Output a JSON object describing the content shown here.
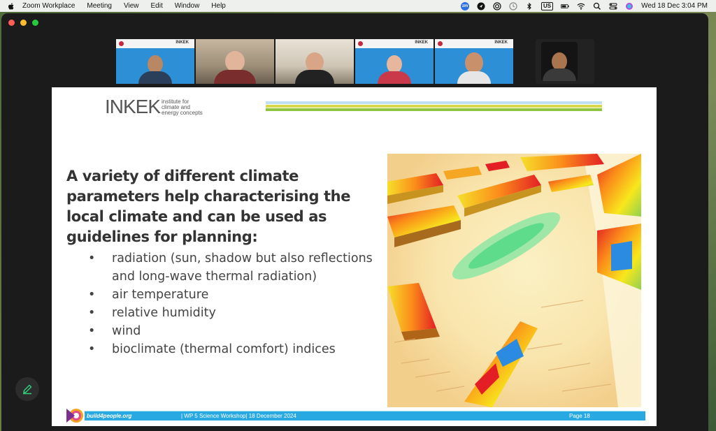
{
  "menubar": {
    "app_name": "Zoom Workplace",
    "menus": [
      "Meeting",
      "View",
      "Edit",
      "Window",
      "Help"
    ],
    "kb_layout": "US",
    "clock": "Wed 18 Dec  3:04 PM",
    "zoom_badge": "zm"
  },
  "participants": {
    "tile_brand": "INKEK",
    "tiles": [
      {
        "type": "blue-banner",
        "active": false
      },
      {
        "type": "room",
        "active": false
      },
      {
        "type": "room2",
        "active": false
      },
      {
        "type": "blue-banner",
        "active": true
      },
      {
        "type": "blue-banner",
        "active": false
      }
    ]
  },
  "slide": {
    "logo_text": "INKEK",
    "logo_subtitle_1": "institute for",
    "logo_subtitle_2": "climate and",
    "logo_subtitle_3": "energy concepts",
    "heading": "A variety of different climate parameters help characterising the local climate and can be used as guidelines for planning:",
    "bullets": [
      "radiation (sun, shadow but also reflections and long-wave thermal radiation)",
      "air temperature",
      "relative humidity",
      "wind",
      "bioclimate (thermal comfort) indices"
    ],
    "bullet_glyph": "•",
    "footer_site": "build4people.org",
    "footer_event": "| WP 5 Science Workshop| 18 December 2024",
    "footer_page": "Page 18",
    "stripe_colors": [
      "#bfe0f2",
      "#d8d84a",
      "#8fc43f"
    ]
  },
  "colors": {
    "footer_bar": "#29a9e1",
    "accent_green": "#27c93f"
  }
}
